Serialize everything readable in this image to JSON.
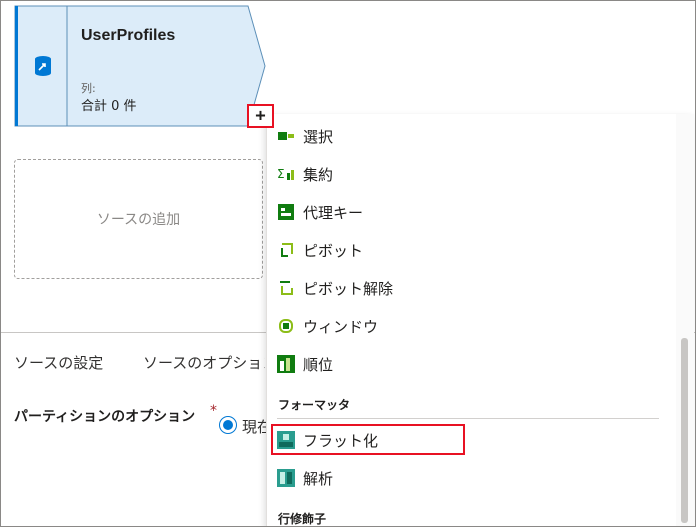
{
  "source_node": {
    "title": "UserProfiles",
    "columns_label": "列:",
    "count_text": "合計 0 件",
    "icon": "source-dataset-icon"
  },
  "add_transform_button": {
    "label": "+"
  },
  "add_source": {
    "label": "ソースの追加"
  },
  "tabs": [
    {
      "label": "ソースの設定"
    },
    {
      "label": "ソースのオプション"
    }
  ],
  "partition": {
    "label": "パーティションのオプション",
    "required_mark": "*",
    "selected_option": "現在"
  },
  "menu": {
    "items": [
      {
        "label": "選択",
        "icon": "select-icon"
      },
      {
        "label": "集約",
        "icon": "aggregate-icon"
      },
      {
        "label": "代理キー",
        "icon": "surrogate-key-icon"
      },
      {
        "label": "ピボット",
        "icon": "pivot-icon"
      },
      {
        "label": "ピボット解除",
        "icon": "unpivot-icon"
      },
      {
        "label": "ウィンドウ",
        "icon": "window-icon"
      },
      {
        "label": "順位",
        "icon": "rank-icon"
      }
    ],
    "formatter_section": "フォーマッタ",
    "formatter_items": [
      {
        "label": "フラット化",
        "icon": "flatten-icon",
        "highlighted": true
      },
      {
        "label": "解析",
        "icon": "parse-icon"
      }
    ],
    "row_modifier_section": "行修飾子"
  },
  "colors": {
    "node_fill": "#dcecf9",
    "node_accent": "#0078d4",
    "highlight": "#e81123",
    "icon_green": "#107c10"
  }
}
